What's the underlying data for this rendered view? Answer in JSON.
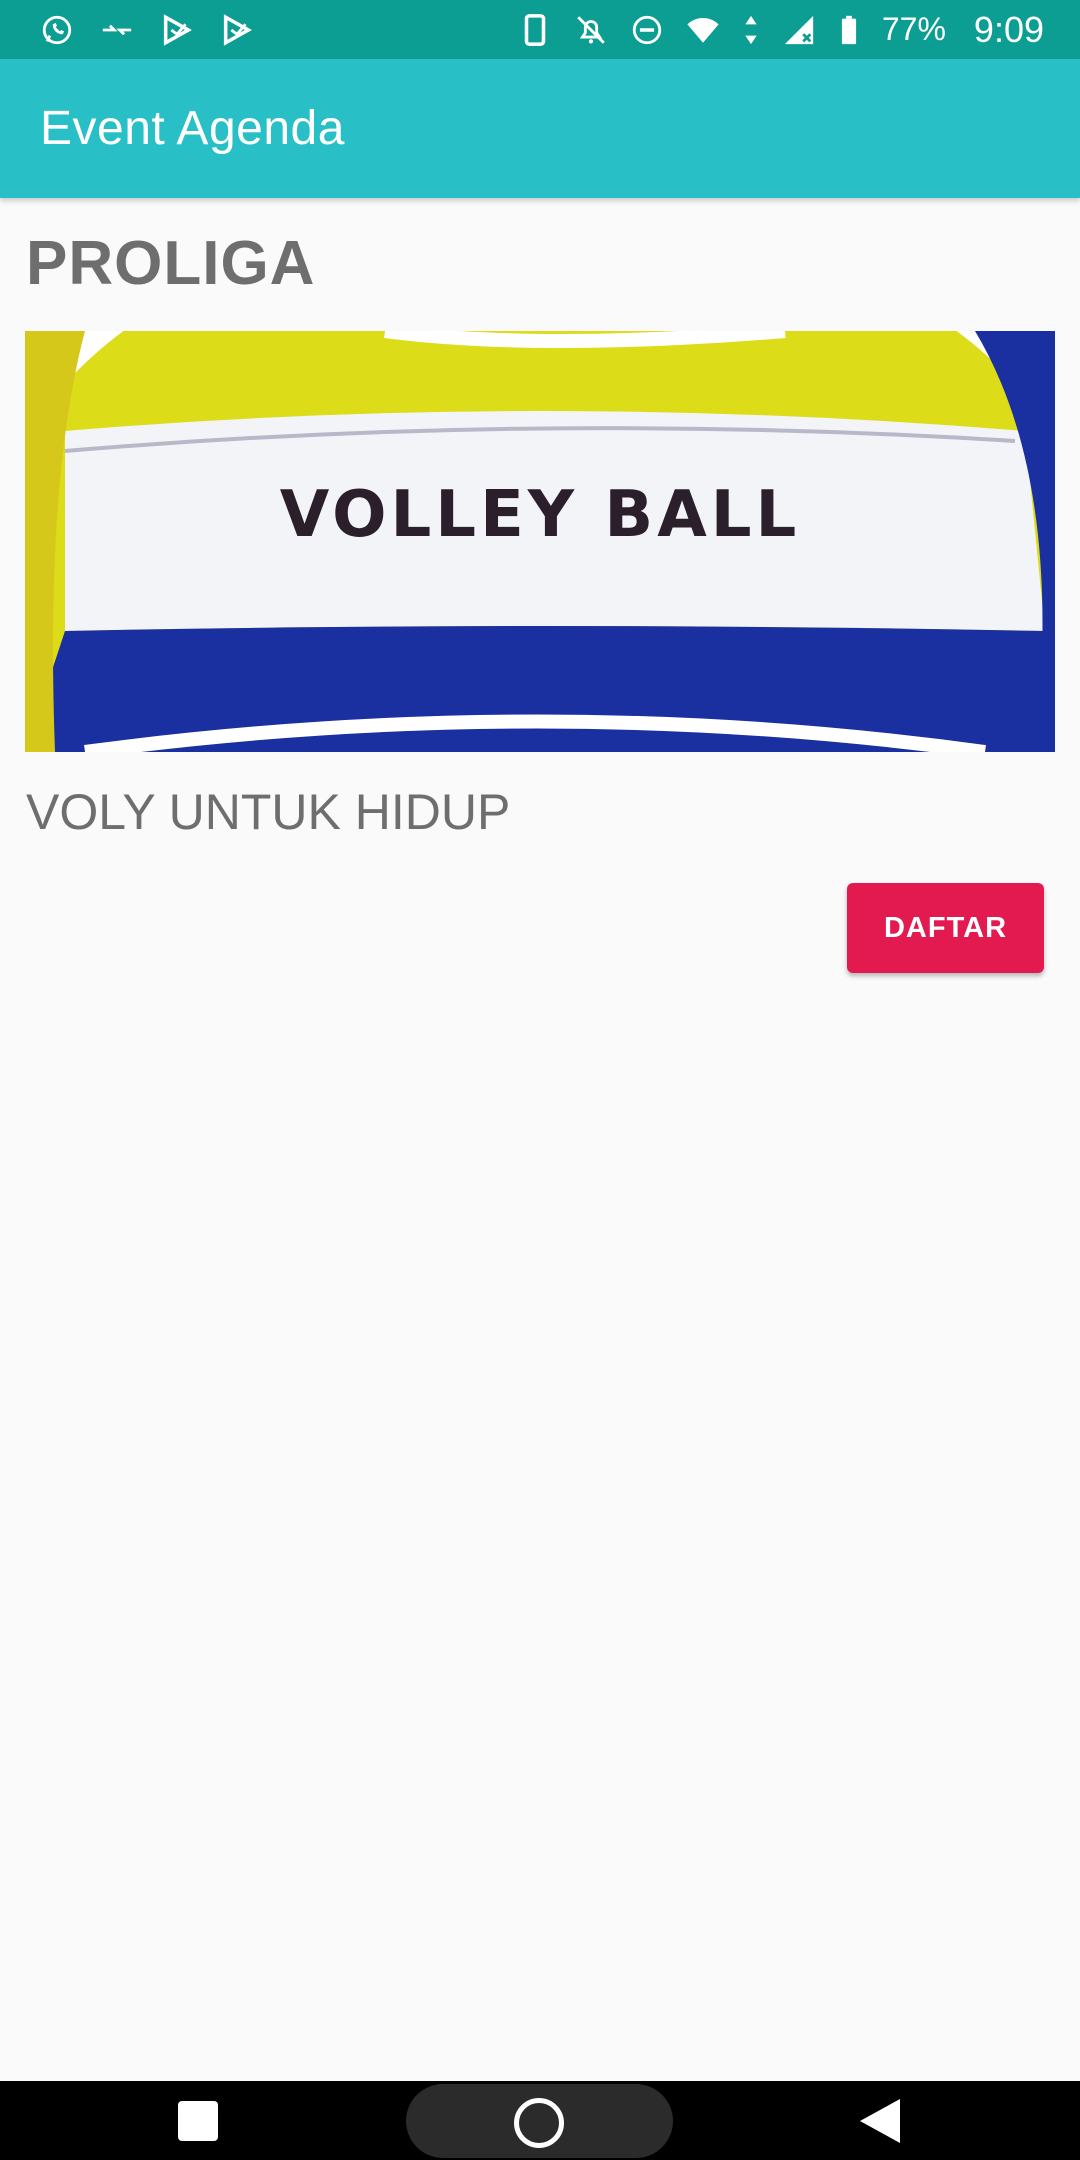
{
  "status_bar": {
    "battery": "77%",
    "time": "9:09",
    "icons_left": [
      "whatsapp-icon",
      "transfer-icon",
      "play-store-icon",
      "play-store-icon"
    ],
    "icons_right": [
      "phone-icon",
      "bell-off-icon",
      "dnd-icon",
      "wifi-icon",
      "data-arrows-icon",
      "signal-icon",
      "battery-icon"
    ]
  },
  "app_bar": {
    "title": "Event Agenda"
  },
  "event": {
    "title": "PROLIGA",
    "image_text": "VOLLEY BALL",
    "description": "VOLY UNTUK HIDUP",
    "button_label": "DAFTAR"
  },
  "colors": {
    "status_bar": "#0d9e93",
    "app_bar": "#28bfc6",
    "button": "#e21a4f",
    "text_gray": "#6e6e6e",
    "background": "#fafafa"
  },
  "nav_bar": {
    "icons": [
      "recent-apps-icon",
      "home-icon",
      "back-icon"
    ]
  }
}
